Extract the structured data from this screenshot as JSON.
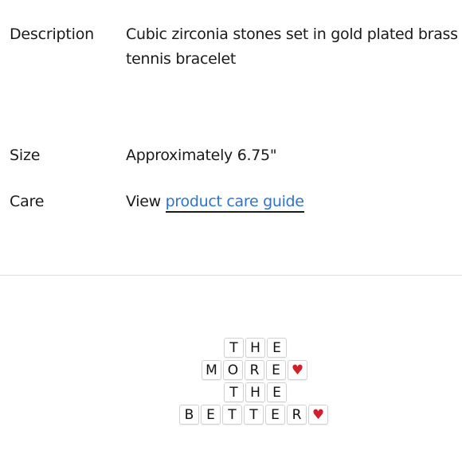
{
  "specs": {
    "description": {
      "label": "Description",
      "value": "Cubic zirconia stones set in gold plated brass tennis bracelet"
    },
    "size": {
      "label": "Size",
      "value": "Approximately 6.75\""
    },
    "care": {
      "label": "Care",
      "prefix": "View",
      "link_text": "product care guide",
      "link_color": "#2a73d9"
    }
  },
  "logo": {
    "rows": [
      [
        "T",
        "H",
        "E"
      ],
      [
        "M",
        "O",
        "R",
        "E",
        "♥"
      ],
      [
        "T",
        "H",
        "E"
      ],
      [
        "B",
        "E",
        "T",
        "T",
        "E",
        "R",
        "♥"
      ]
    ],
    "heart_color": "#d0202b"
  }
}
